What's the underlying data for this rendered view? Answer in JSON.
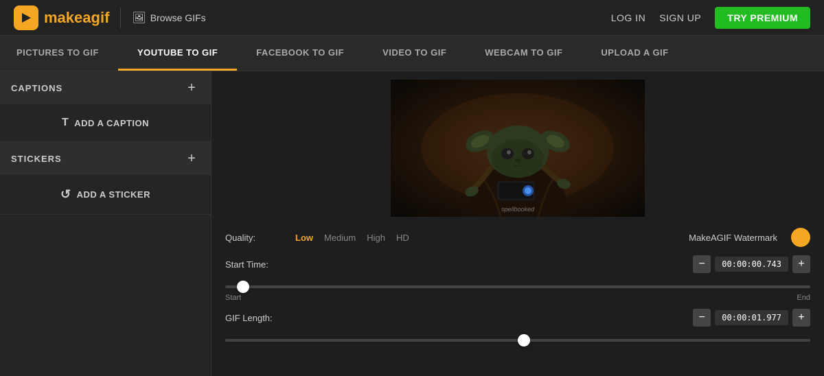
{
  "header": {
    "logo_make": "make",
    "logo_gif": "agif",
    "browse_label": "Browse GIFs",
    "nav_login": "LOG IN",
    "nav_signup": "SIGN UP",
    "btn_premium": "TRY PREMIUM"
  },
  "nav_tabs": [
    {
      "id": "pictures",
      "label": "PICTURES TO GIF",
      "active": false
    },
    {
      "id": "youtube",
      "label": "YOUTUBE TO GIF",
      "active": true
    },
    {
      "id": "facebook",
      "label": "FACEBOOK TO GIF",
      "active": false
    },
    {
      "id": "video",
      "label": "VIDEO TO GIF",
      "active": false
    },
    {
      "id": "webcam",
      "label": "WEBCAM TO GIF",
      "active": false
    },
    {
      "id": "upload",
      "label": "UPLOAD A GIF",
      "active": false
    }
  ],
  "sidebar": {
    "captions_title": "CAPTIONS",
    "add_caption_label": "ADD A CAPTION",
    "stickers_title": "STICKERS",
    "add_sticker_label": "ADD A STICKER"
  },
  "controls": {
    "quality_label": "Quality:",
    "quality_options": [
      "Low",
      "Medium",
      "High",
      "HD"
    ],
    "active_quality": "Low",
    "watermark_label": "MakeAGIF Watermark",
    "start_time_label": "Start Time:",
    "start_time_value": "00:00:00.743",
    "gif_length_label": "GIF Length:",
    "gif_length_value": "00:00:01.977",
    "slider_start": "Start",
    "slider_end": "End"
  },
  "gif": {
    "watermark_text": "spellbooked"
  }
}
